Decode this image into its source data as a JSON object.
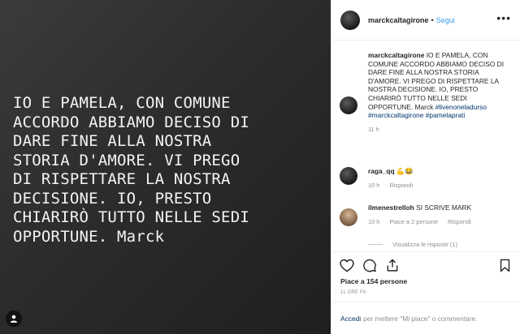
{
  "post": {
    "text": "IO E PAMELA, CON COMUNE\nACCORDO ABBIAMO DECISO DI\nDARE FINE ALLA NOSTRA\nSTORIA D'AMORE. VI PREGO\nDI RISPETTARE LA NOSTRA\nDECISIONE. IO, PRESTO\nCHIARIRÒ TUTTO NELLE SEDI\nOPPORTUNE. Marck",
    "tag_icon": "person-icon"
  },
  "header": {
    "username": "marckcaltagirone",
    "separator": "•",
    "follow_label": "Segui",
    "more_label": "•••"
  },
  "caption": {
    "username": "marckcaltagirone",
    "text": "IO E PAMELA, CON COMUNE ACCORDO ABBIAMO DECISO DI DARE FINE ALLA NOSTRA STORIA D'AMORE. VI PREGO DI RISPETTARE LA NOSTRA DECISIONE. IO, PRESTO CHIARIRÒ TUTTO NELLE SEDI OPPORTUNE. Marck",
    "hashtags": [
      "#livenoneladurso",
      "#marckcaltagirone",
      "#pamelaprati"
    ],
    "time": "11 h"
  },
  "comments": [
    {
      "username": "raga_qq",
      "text": "💪😂",
      "time": "10 h",
      "reply_label": "Rispondi"
    },
    {
      "username": "ilmenestrelloh",
      "text": "SI SCRIVE MARK",
      "time": "10 h",
      "likes_label": "Piace a 2 persone",
      "reply_label": "Rispondi"
    }
  ],
  "view_replies": "Visualizza le risposte (1)",
  "actions": {
    "likes": "Piace a 154 persone",
    "time": "11 ORE FA"
  },
  "login": {
    "link": "Accedi",
    "text": "per mettere \"Mi piace\" o commentare."
  }
}
